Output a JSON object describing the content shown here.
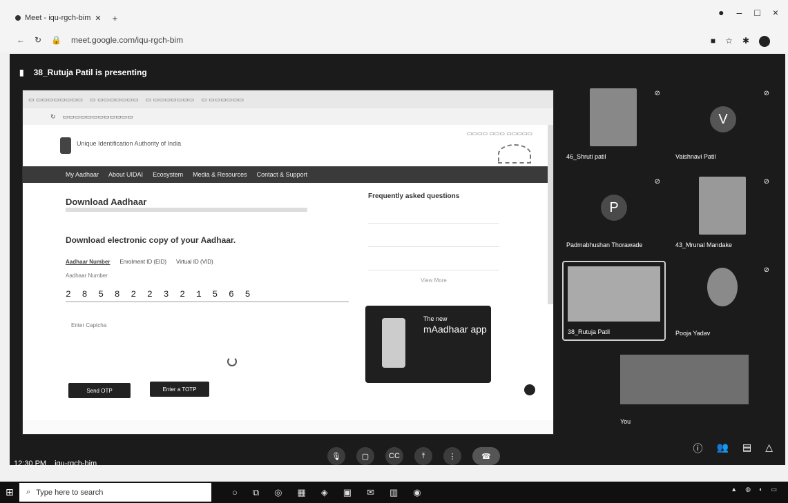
{
  "browser": {
    "tab_title": "Meet - iqu-rgch-bim",
    "url": "meet.google.com/iqu-rgch-bim",
    "new_tab": "+",
    "win_min": "–",
    "win_max": "□",
    "win_close": "×"
  },
  "meet": {
    "presenting_text": "38_Rutuja Patil is presenting",
    "time": "12:30 PM",
    "code": "iqu-rgch-bim"
  },
  "shared_screen": {
    "uidai_org": "Unique Identification Authority of India",
    "nav": [
      "My Aadhaar",
      "About UIDAI",
      "Ecosystem",
      "Media & Resources",
      "Contact & Support"
    ],
    "heading": "Download Aadhaar",
    "subheading": "Download electronic copy of your Aadhaar.",
    "option_selected": "Aadhaar Number",
    "option_2": "Enrolment ID (EID)",
    "option_3": "Virtual ID (VID)",
    "field_label": "Aadhaar Number",
    "aadhaar_number": "2 8 5 8 2 2 3 2 1 5 6 5",
    "captcha_label": "Enter Captcha",
    "send_otp": "Send OTP",
    "enter_totp": "Enter a TOTP",
    "faq_title": "Frequently asked questions",
    "faq_more": "View More",
    "app_new": "The new",
    "app_name": "mAadhaar app"
  },
  "participants": [
    {
      "name": "46_Shruti patil",
      "letter": ""
    },
    {
      "name": "Vaishnavi Patil",
      "letter": "V"
    },
    {
      "name": "Padmabhushan Thorawade",
      "letter": "P"
    },
    {
      "name": "43_Mrunal Mandake",
      "letter": ""
    },
    {
      "name": "38_Rutuja Patil",
      "letter": ""
    },
    {
      "name": "Pooja Yadav",
      "letter": ""
    },
    {
      "name": "You",
      "letter": ""
    }
  ],
  "taskbar": {
    "search_placeholder": "Type here to search"
  }
}
